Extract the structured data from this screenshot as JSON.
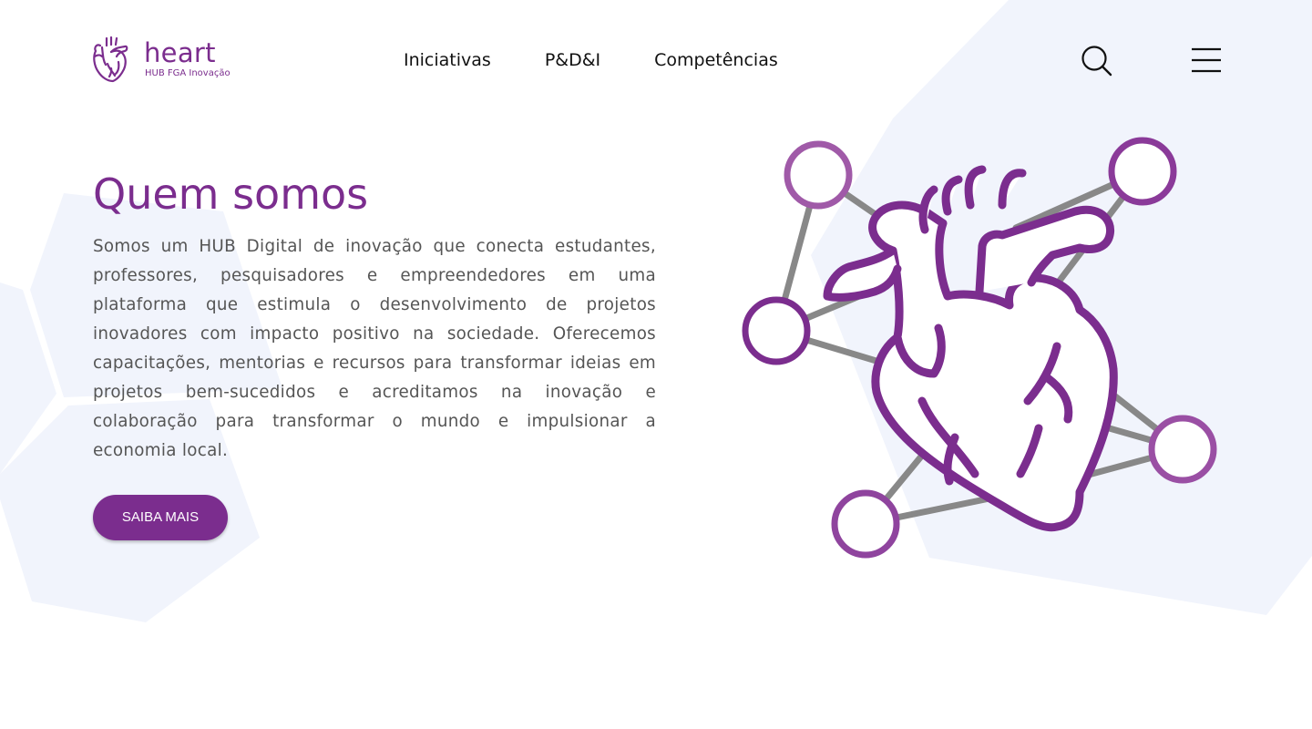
{
  "brand": {
    "name": "heart",
    "tagline": "HUB FGA Inovação",
    "color": "#7b2d8e"
  },
  "nav": {
    "items": [
      {
        "label": "Iniciativas"
      },
      {
        "label": "P&D&I"
      },
      {
        "label": "Competências"
      }
    ]
  },
  "header_actions": {
    "search_icon": "search-icon",
    "menu_icon": "hamburger-menu-icon"
  },
  "hero": {
    "title": "Quem somos",
    "body": "Somos um HUB Digital de inovação que conecta estudantes, professores, pesquisadores e empreendedores em uma plataforma que estimula o desenvolvimento de projetos inovadores com impacto positivo na sociedade. Oferecemos capacitações, mentorias e recursos para transformar ideias em projetos bem-sucedidos e acreditamos na inovação e colaboração para transformar o mundo e impulsionar a economia local.",
    "cta_label": "SAIBA MAIS",
    "illustration": "anatomical-heart-network-illustration"
  },
  "colors": {
    "accent": "#7b2d8e",
    "hexagon_bg": "#f1f4fc",
    "network_line": "#8a8a8a",
    "text": "#555555"
  }
}
